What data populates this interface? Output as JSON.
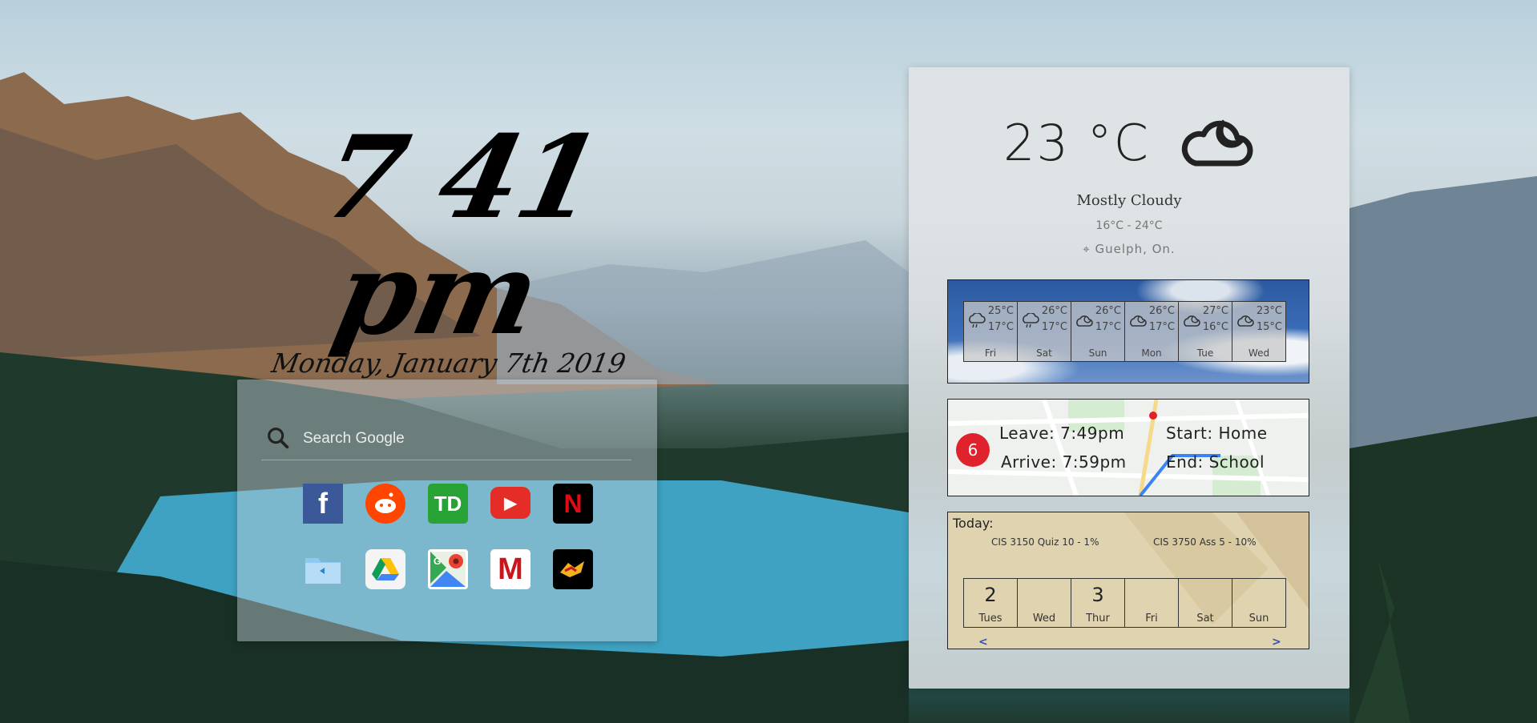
{
  "clock": {
    "time": "7 41 pm",
    "date": "Monday, January 7th 2019"
  },
  "search": {
    "placeholder": "Search Google"
  },
  "shortcuts": [
    {
      "name": "facebook",
      "label": "f",
      "color": "#3b5998"
    },
    {
      "name": "reddit",
      "label": "",
      "color": "#ff4500"
    },
    {
      "name": "td",
      "label": "TD",
      "color": "#2aa336"
    },
    {
      "name": "youtube",
      "label": "▶",
      "color": "#e52d27"
    },
    {
      "name": "netflix",
      "label": "N",
      "color": "#000000"
    },
    {
      "name": "files",
      "label": "",
      "color": "#cfe6f7"
    },
    {
      "name": "google-drive",
      "label": "",
      "color": "#f4f4f4"
    },
    {
      "name": "google-maps",
      "label": "G",
      "color": "#ffffff"
    },
    {
      "name": "gmail",
      "label": "M",
      "color": "#ffffff"
    },
    {
      "name": "guelph-gryphons",
      "label": "",
      "color": "#000000"
    }
  ],
  "weather": {
    "temp": "23 °C",
    "condition": "Mostly Cloudy",
    "range": "16°C - 24°C",
    "location": "Guelph, On.",
    "forecast": [
      {
        "day": "Fri",
        "hi": "25°C",
        "lo": "17°C",
        "icon": "rain-cloud-icon"
      },
      {
        "day": "Sat",
        "hi": "26°C",
        "lo": "17°C",
        "icon": "rain-cloud-icon"
      },
      {
        "day": "Sun",
        "hi": "26°C",
        "lo": "17°C",
        "icon": "partly-cloudy-icon"
      },
      {
        "day": "Mon",
        "hi": "26°C",
        "lo": "17°C",
        "icon": "partly-cloudy-icon"
      },
      {
        "day": "Tue",
        "hi": "27°C",
        "lo": "16°C",
        "icon": "partly-cloudy-icon"
      },
      {
        "day": "Wed",
        "hi": "23°C",
        "lo": "15°C",
        "icon": "partly-cloudy-icon"
      }
    ]
  },
  "commute": {
    "badge": "6",
    "leave": "Leave: 7:49pm",
    "arrive": "Arrive: 7:59pm",
    "start": "Start: Home",
    "end": "End: School"
  },
  "calendar": {
    "title": "Today:",
    "events": [
      "CIS 3150 Quiz 10 - 1%",
      "CIS 3750 Ass 5 - 10%"
    ],
    "days": [
      {
        "num": "2",
        "day": "Tues"
      },
      {
        "num": "",
        "day": "Wed"
      },
      {
        "num": "3",
        "day": "Thur"
      },
      {
        "num": "",
        "day": "Fri"
      },
      {
        "num": "",
        "day": "Sat"
      },
      {
        "num": "",
        "day": "Sun"
      }
    ],
    "prev": "<",
    "next": ">"
  }
}
